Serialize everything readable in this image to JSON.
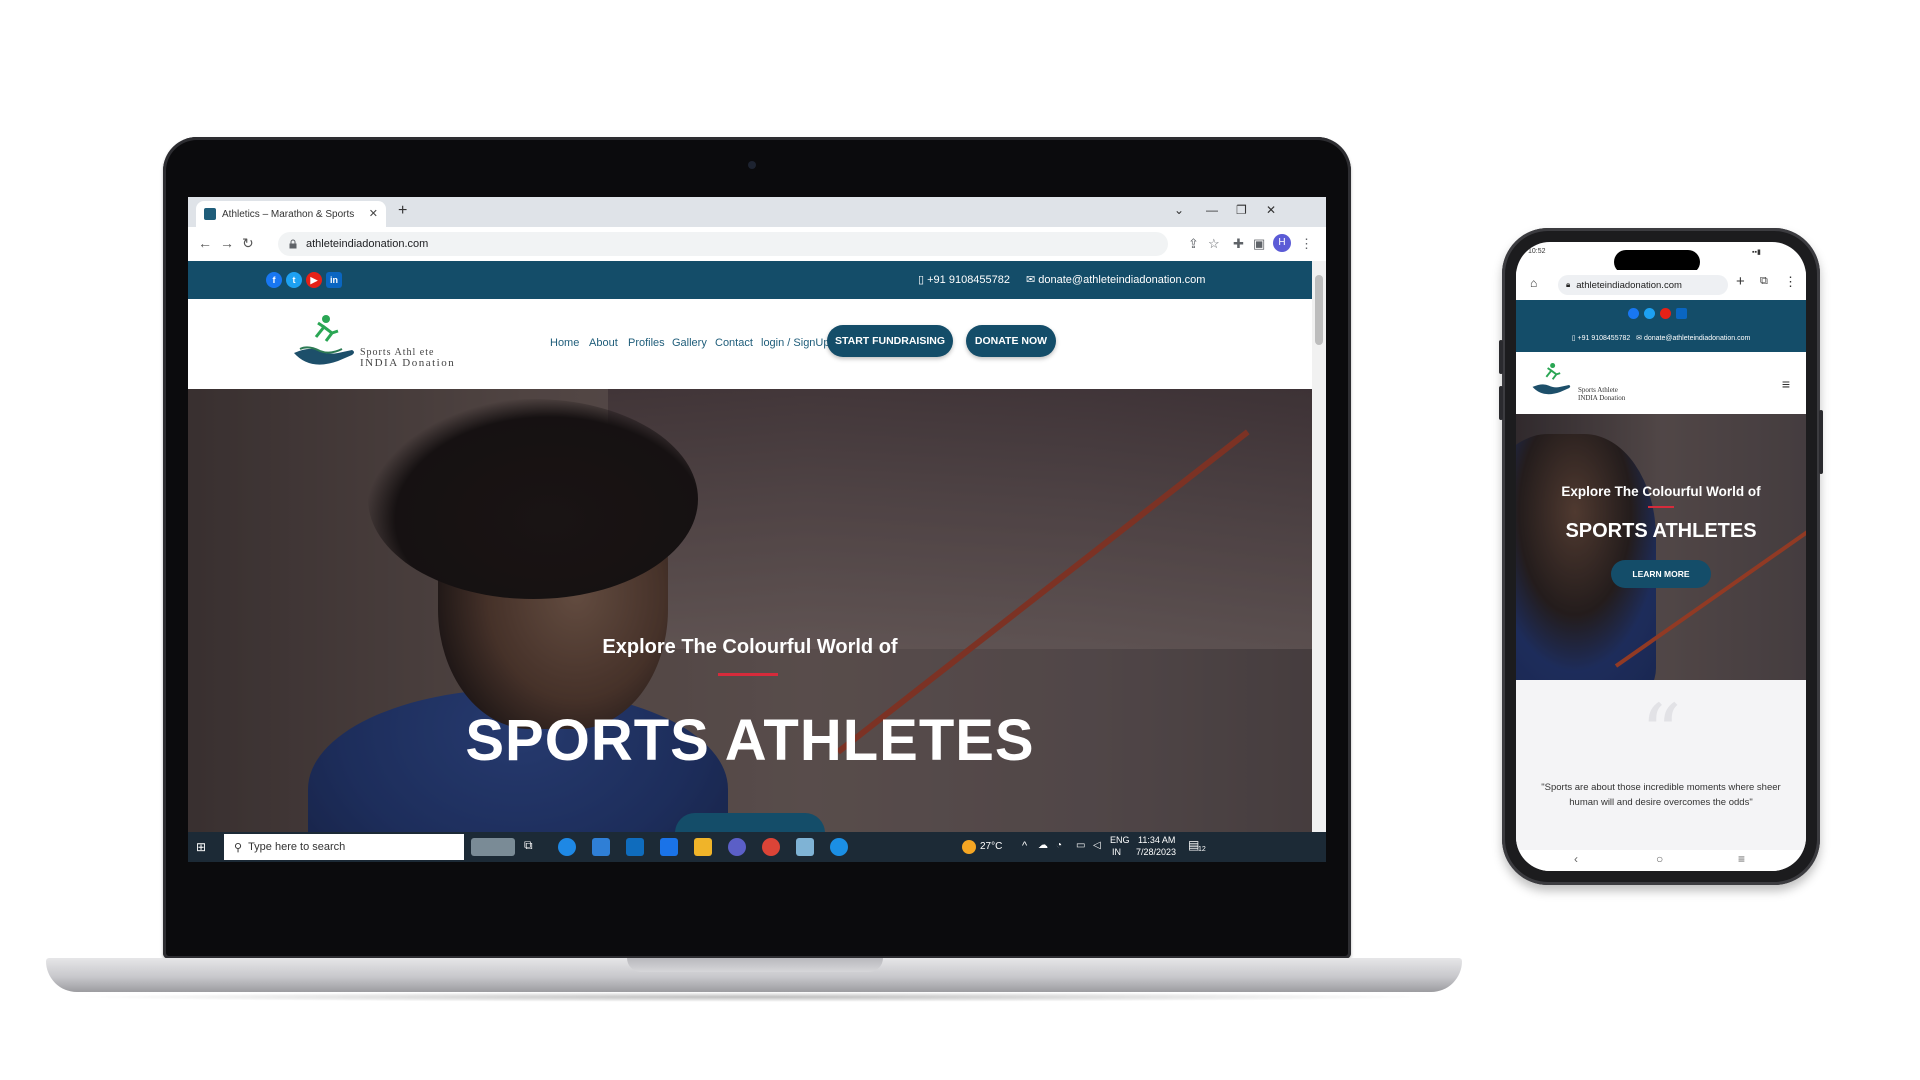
{
  "browser": {
    "tab_title": "Athletics – Marathon & Sports",
    "url": "athleteindiadonation.com",
    "profile_initial": "H"
  },
  "site": {
    "phone": "+91 9108455782",
    "email": "donate@athleteindiadonation.com",
    "logo_line1": "Sports Athl ete",
    "logo_line2": "INDIA Donation",
    "nav": [
      "Home",
      "About",
      "Profiles",
      "Gallery",
      "Contact",
      "login / SignUp"
    ],
    "btn_fundraising": "START FUNDRAISING",
    "btn_donate": "DONATE NOW",
    "hero_subtitle": "Explore The Colourful World of",
    "hero_title": "SPORTS ATHLETES"
  },
  "taskbar": {
    "search_placeholder": "Type here to search",
    "weather": "27°C",
    "lang1": "ENG",
    "lang2": "IN",
    "time": "11:34 AM",
    "date": "7/28/2023",
    "notifications": "12"
  },
  "phone": {
    "time": "10:52",
    "url": "athleteindiadonation.com",
    "phone_num": "+91 9108455782",
    "email": "donate@athleteindiadonation.com",
    "logo_line1": "Sports Athlete",
    "logo_line2": "INDIA Donation",
    "hero_subtitle": "Explore The Colourful World of",
    "hero_title": "SPORTS ATHLETES",
    "learn_more": "LEARN MORE",
    "quote": "\"Sports are about those incredible moments where sheer human will and desire overcomes the odds\""
  },
  "colors": {
    "brand": "#144d69",
    "accent_red": "#d62b3b"
  }
}
